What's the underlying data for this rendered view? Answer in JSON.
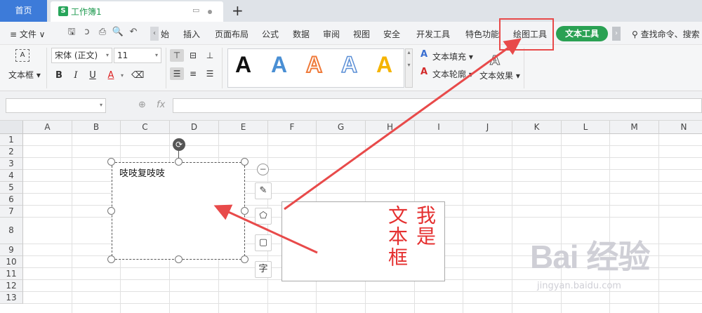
{
  "tabs": {
    "home": "首页",
    "doc_badge": "S",
    "doc_name": "工作簿1",
    "add": "+"
  },
  "menubar": {
    "file": "≡ 文件 ∨",
    "items": [
      "始",
      "插入",
      "页面布局",
      "公式",
      "数据",
      "审阅",
      "视图",
      "安全",
      "开发工具",
      "特色功能",
      "绘图工具"
    ],
    "active": "文本工具",
    "search": "查找命令、搜索"
  },
  "ribbon": {
    "textbox_label": "文本框",
    "font_name": "宋体 (正文)",
    "font_size": "11",
    "bold": "B",
    "italic": "I",
    "underline": "U",
    "font_color": "A",
    "gallery_glyph": "A",
    "text_fill": "文本填充",
    "text_outline": "文本轮廓",
    "text_effect": "文本效果"
  },
  "formula_bar": {
    "fx": "fx"
  },
  "sheet": {
    "columns": [
      "A",
      "B",
      "C",
      "D",
      "E",
      "F",
      "G",
      "H",
      "I",
      "J",
      "K",
      "L",
      "M",
      "N"
    ],
    "rows": [
      "1",
      "2",
      "3",
      "4",
      "5",
      "6",
      "7",
      "8",
      "9",
      "10",
      "11",
      "12",
      "13"
    ]
  },
  "textbox1": {
    "text": "吱吱复吱吱"
  },
  "textbox2": {
    "col1": "我是",
    "col2": "文本框"
  },
  "side_tools": [
    "✎",
    "⬠",
    "▢",
    "字"
  ],
  "watermark": {
    "main": "Bai 经验",
    "sub": "jingyan.baidu.com"
  },
  "colors": {
    "accent_blue": "#3d7bd9",
    "accent_green": "#2aa153",
    "annotation_red": "#e84a4a",
    "text_red": "#e53030"
  }
}
